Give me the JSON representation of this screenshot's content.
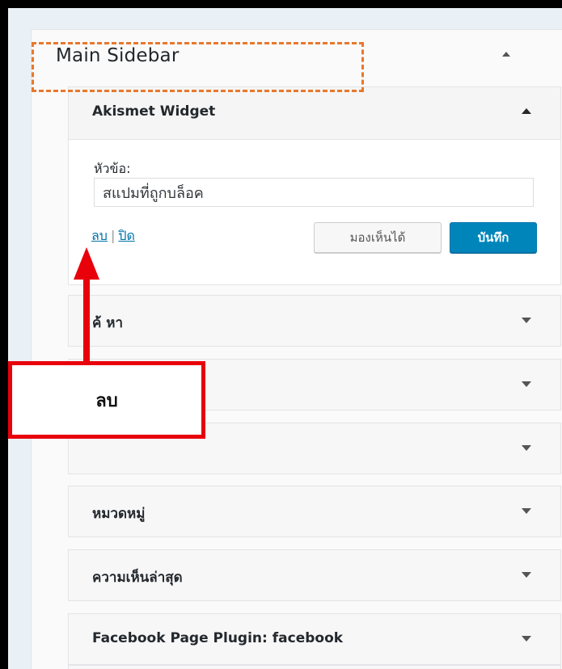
{
  "panel": {
    "title": "Main Sidebar"
  },
  "expanded_widget": {
    "title": "Akismet Widget",
    "field_label": "หัวข้อ:",
    "field_value": "สแปมที่ถูกบล็อค",
    "delete_link": "ลบ",
    "separator": "|",
    "close_link": "ปิด",
    "visible_button": "มองเห็นได้",
    "save_button": "บันทึก"
  },
  "widgets": [
    {
      "title": "ค้นหา",
      "visible_text": "ค้ หา"
    },
    {
      "title": "",
      "visible_text": ""
    },
    {
      "title": "",
      "visible_text": ""
    },
    {
      "title": "หมวดหมู่",
      "visible_text": "หมวดหมู่"
    },
    {
      "title": "ความเห็นล่าสุด",
      "visible_text": "ความเห็นล่าสุด"
    },
    {
      "title": "Facebook Page Plugin: facebook",
      "visible_text": "Facebook Page Plugin: facebook"
    }
  ],
  "annotation": {
    "label": "ลบ"
  },
  "colors": {
    "highlight_dashed": "#e8782d",
    "callout_border": "#e8000b",
    "arrow": "#e8000b",
    "save_button": "#0085ba"
  }
}
